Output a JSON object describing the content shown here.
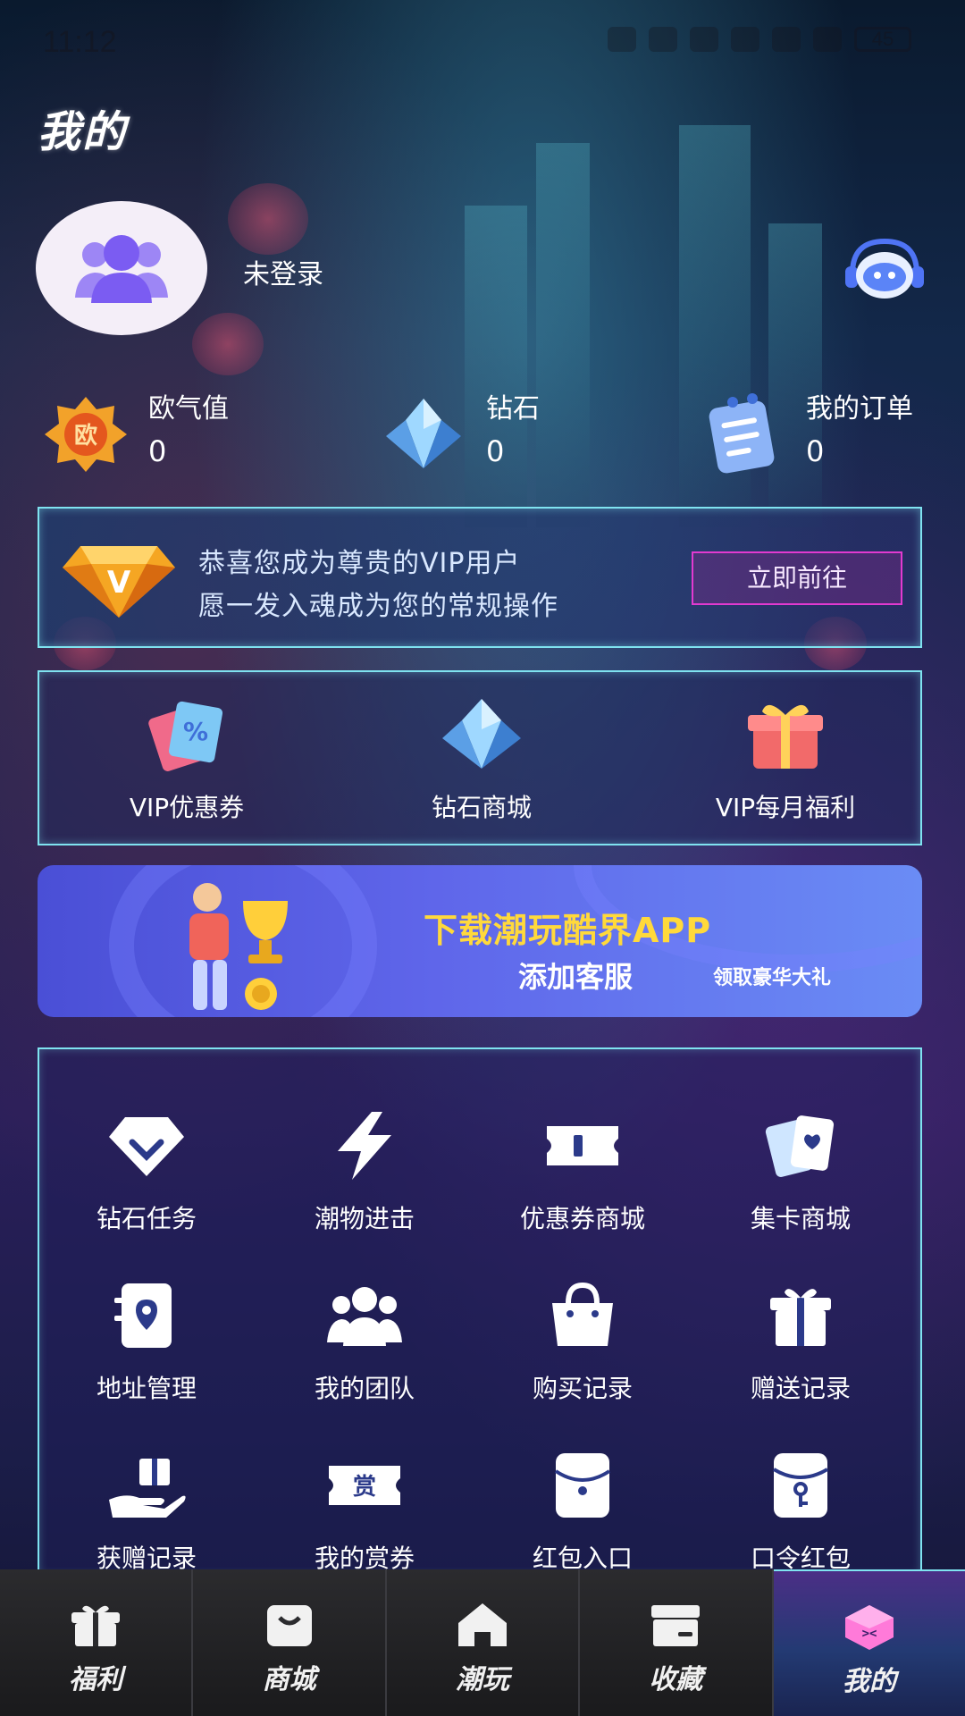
{
  "status_bar": {
    "time": "11:12",
    "battery": "45"
  },
  "header": {
    "title": "我的"
  },
  "profile": {
    "login_status": "未登录"
  },
  "stats": [
    {
      "label": "欧气值",
      "value": "0",
      "icon": "luck-badge-icon"
    },
    {
      "label": "钻石",
      "value": "0",
      "icon": "diamond-icon"
    },
    {
      "label": "我的订单",
      "value": "0",
      "icon": "order-clipboard-icon"
    }
  ],
  "vip_banner": {
    "line1": "恭喜您成为尊贵的VIP用户",
    "line2": "愿一发入魂成为您的常规操作",
    "button": "立即前往",
    "badge_letter": "V"
  },
  "quick_entries": [
    {
      "label": "VIP优惠券",
      "icon": "coupon-icon"
    },
    {
      "label": "钻石商城",
      "icon": "diamond-store-icon"
    },
    {
      "label": "VIP每月福利",
      "icon": "gift-box-icon"
    }
  ],
  "promo": {
    "line1": "下载潮玩酷界APP",
    "line2": "添加客服",
    "line3": "领取豪华大礼"
  },
  "functions": [
    {
      "label": "钻石任务",
      "icon": "diamond-task-icon"
    },
    {
      "label": "潮物进击",
      "icon": "lightning-icon"
    },
    {
      "label": "优惠券商城",
      "icon": "ticket-icon"
    },
    {
      "label": "集卡商城",
      "icon": "cards-icon"
    },
    {
      "label": "地址管理",
      "icon": "address-icon"
    },
    {
      "label": "我的团队",
      "icon": "team-icon"
    },
    {
      "label": "购买记录",
      "icon": "shopping-bag-icon"
    },
    {
      "label": "赠送记录",
      "icon": "gift-icon"
    },
    {
      "label": "获赠记录",
      "icon": "receive-gift-icon"
    },
    {
      "label": "我的赏券",
      "icon": "reward-ticket-icon",
      "icon_text": "赏"
    },
    {
      "label": "红包入口",
      "icon": "red-packet-icon"
    },
    {
      "label": "口令红包",
      "icon": "password-packet-icon"
    }
  ],
  "tabs": [
    {
      "label": "福利",
      "icon": "gift-icon",
      "active": false
    },
    {
      "label": "商城",
      "icon": "shop-bag-icon",
      "active": false
    },
    {
      "label": "潮玩",
      "icon": "home-icon",
      "active": false
    },
    {
      "label": "收藏",
      "icon": "box-icon",
      "active": false
    },
    {
      "label": "我的",
      "icon": "cube-face-icon",
      "active": true
    }
  ],
  "colors": {
    "panel_border": "#7fe3f0",
    "vip_button": "#e23ad0",
    "promo_yellow": "#ffd93b",
    "icon_purple": "#7b5cf2"
  }
}
